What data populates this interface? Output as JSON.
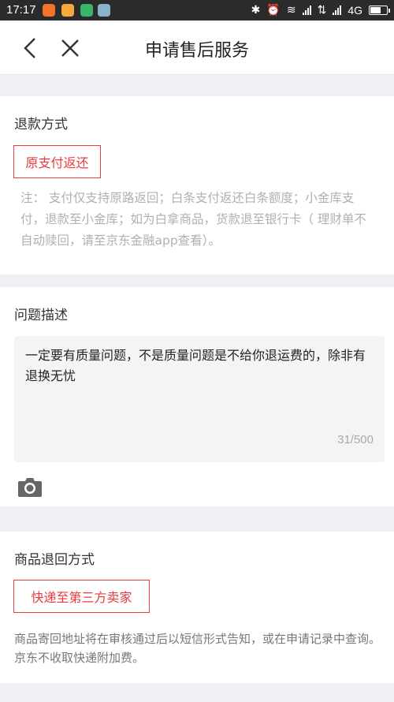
{
  "status_bar": {
    "time": "17:17",
    "network": "4G",
    "app_icon_colors": [
      "#f0742a",
      "#f7a83a",
      "#38b56a",
      "#8ab4c8"
    ]
  },
  "nav": {
    "title": "申请售后服务",
    "back_icon": "chevron-left-icon",
    "close_icon": "close-icon"
  },
  "refund": {
    "title": "退款方式",
    "option": "原支付返还",
    "note": "注：  支付仅支持原路返回；白条支付返还白条额度；小金库支付，退款至小金库；如为白拿商品，货款退至银行卡（ 理财单不自动赎回，请至京东金融app查看）。"
  },
  "problem": {
    "title": "问题描述",
    "text": "一定要有质量问题，不是质量问题是不给你退运费的，除非有退换无忧",
    "counter": "31/500",
    "camera_icon": "camera-icon"
  },
  "return": {
    "title": "商品退回方式",
    "option": "快递至第三方卖家",
    "info": "商品寄回地址将在审核通过后以短信形式告知，或在申请记录中查询。京东不收取快递附加费。"
  },
  "colors": {
    "accent": "#e93b3d",
    "background": "#f0f1f5"
  }
}
